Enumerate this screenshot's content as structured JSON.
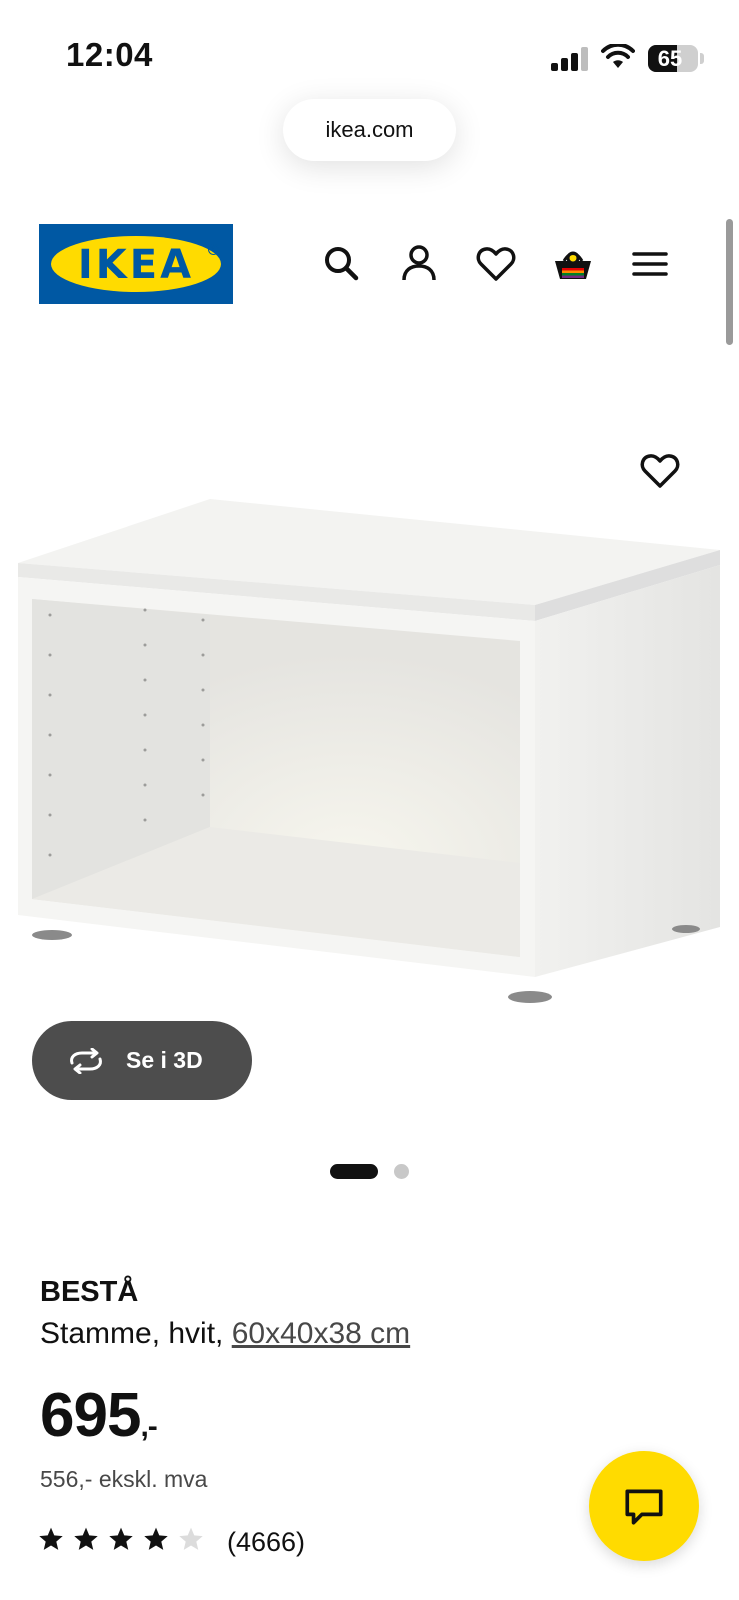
{
  "status_bar": {
    "time": "12:04",
    "battery": "65",
    "battery_level": 0.65
  },
  "browser": {
    "url": "ikea.com"
  },
  "header": {
    "logo_text": "IKEA",
    "icons": [
      "search-icon",
      "user-icon",
      "heart-icon",
      "basket-icon",
      "menu-icon"
    ]
  },
  "product": {
    "view_3d_label": "Se i 3D",
    "image_count": 2,
    "active_image": 1,
    "name": "BESTÅ",
    "description": "Stamme, hvit, ",
    "dimensions": "60x40x38 cm",
    "price": "695",
    "price_suffix": ",-",
    "price_excl_vat": "556,- ekskl. mva",
    "rating": 4,
    "rating_max": 5,
    "review_count": "(4666)"
  },
  "colors": {
    "ikea_blue": "#0058a3",
    "ikea_yellow": "#ffdb00",
    "pill_dark": "#4d4d4d"
  }
}
